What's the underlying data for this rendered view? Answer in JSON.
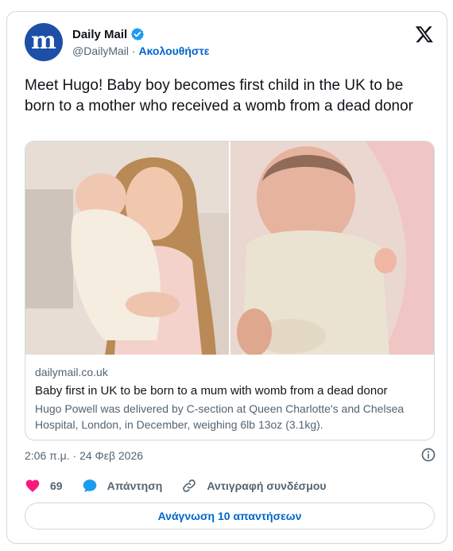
{
  "author": {
    "avatar_letter": "m",
    "name": "Daily Mail",
    "handle": "@DailyMail",
    "separator": " · ",
    "follow_label": "Ακολουθήστε"
  },
  "tweet": {
    "text": "Meet Hugo! Baby boy becomes first child in the UK to be born to a mother who received a womb from a dead donor"
  },
  "link_card": {
    "domain": "dailymail.co.uk",
    "title": "Baby first in UK to be born to a mum with womb from a dead donor",
    "description": "Hugo Powell was delivered by C-section at Queen Charlotte's and Chelsea Hospital, London, in December, weighing 6lb 13oz (3.1kg)."
  },
  "timestamp": "2:06 π.μ. · 24 Φεβ 2026",
  "actions": {
    "likes": "69",
    "reply_label": "Απάντηση",
    "copy_link_label": "Αντιγραφή συνδέσμου"
  },
  "read_replies_label": "Ανάγνωση 10 απαντήσεων",
  "colors": {
    "accent": "#0066cc",
    "verified": "#1d9bf0",
    "like": "#f91880",
    "avatar_bg": "#1d4fa6",
    "muted": "#536471",
    "border": "#cfd9de"
  },
  "icons": [
    "verified-badge-icon",
    "x-logo-icon",
    "info-icon",
    "heart-icon",
    "reply-bubble-icon",
    "link-icon"
  ]
}
